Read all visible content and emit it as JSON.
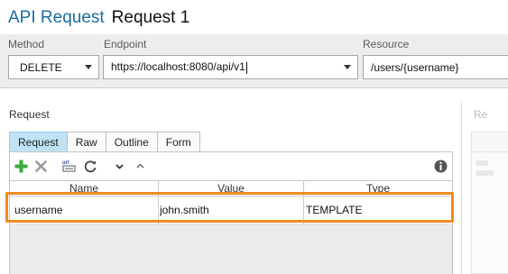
{
  "header": {
    "app_title": "API Request",
    "request_name": "Request 1"
  },
  "params": {
    "method_label": "Method",
    "method_value": "DELETE",
    "endpoint_label": "Endpoint",
    "endpoint_value": "https://localhost:8080/api/v1",
    "resource_label": "Resource",
    "resource_value": "/users/{username}"
  },
  "request": {
    "section_label": "Request",
    "tabs": [
      {
        "label": "Request",
        "active": true
      },
      {
        "label": "Raw",
        "active": false
      },
      {
        "label": "Outline",
        "active": false
      },
      {
        "label": "Form",
        "active": false
      }
    ],
    "toolbar": {
      "icons": [
        "add-icon",
        "delete-icon",
        "url-encode-icon",
        "refresh-icon",
        "move-down-icon",
        "move-up-icon",
        "info-icon"
      ],
      "colors": {
        "add": "#3aa83a",
        "delete": "#9a9a9a",
        "info": "#555555",
        "highlight": "#f08a1f",
        "active_tab": "#bfe3f5"
      }
    },
    "columns": [
      "Name",
      "Value",
      "Type"
    ],
    "rows": [
      {
        "name": "username",
        "value": "john.smith",
        "type": "TEMPLATE"
      }
    ]
  }
}
